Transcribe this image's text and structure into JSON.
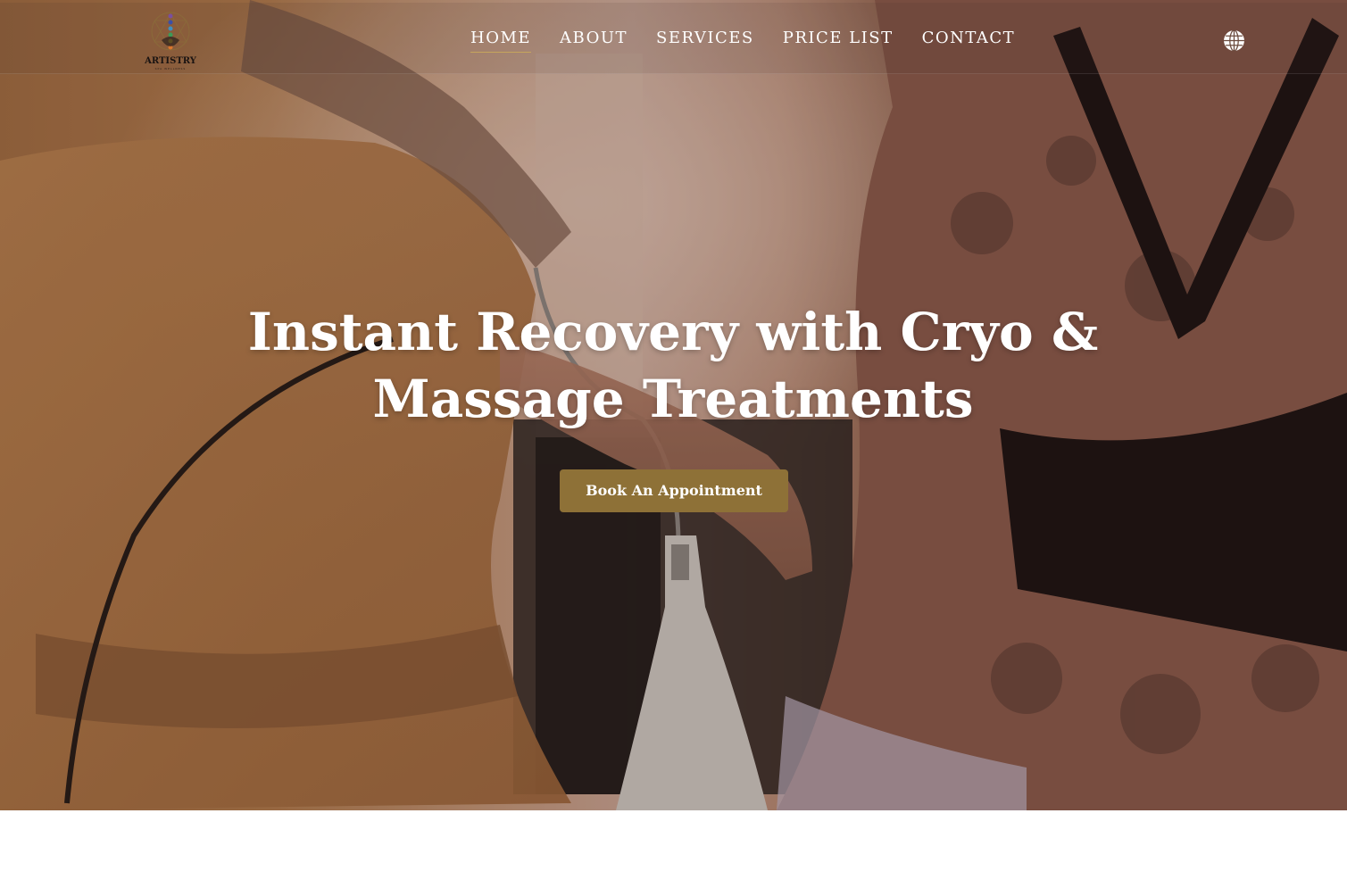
{
  "brand": {
    "name": "ARTISTRY",
    "tagline": "SPA WELLNESS"
  },
  "nav": {
    "items": [
      {
        "label": "HOME",
        "active": true
      },
      {
        "label": "ABOUT",
        "active": false
      },
      {
        "label": "SERVICES",
        "active": false
      },
      {
        "label": "PRICE LIST",
        "active": false
      },
      {
        "label": "CONTACT",
        "active": false
      }
    ],
    "language_icon": "globe-icon"
  },
  "hero": {
    "title": "Instant Recovery with Cryo & Massage Treatments",
    "cta_label": "Book An Appointment"
  },
  "colors": {
    "accent": "#8e7137",
    "nav_underline": "#c6a55c",
    "top_strip": "#4d3f62",
    "text": "#ffffff"
  }
}
